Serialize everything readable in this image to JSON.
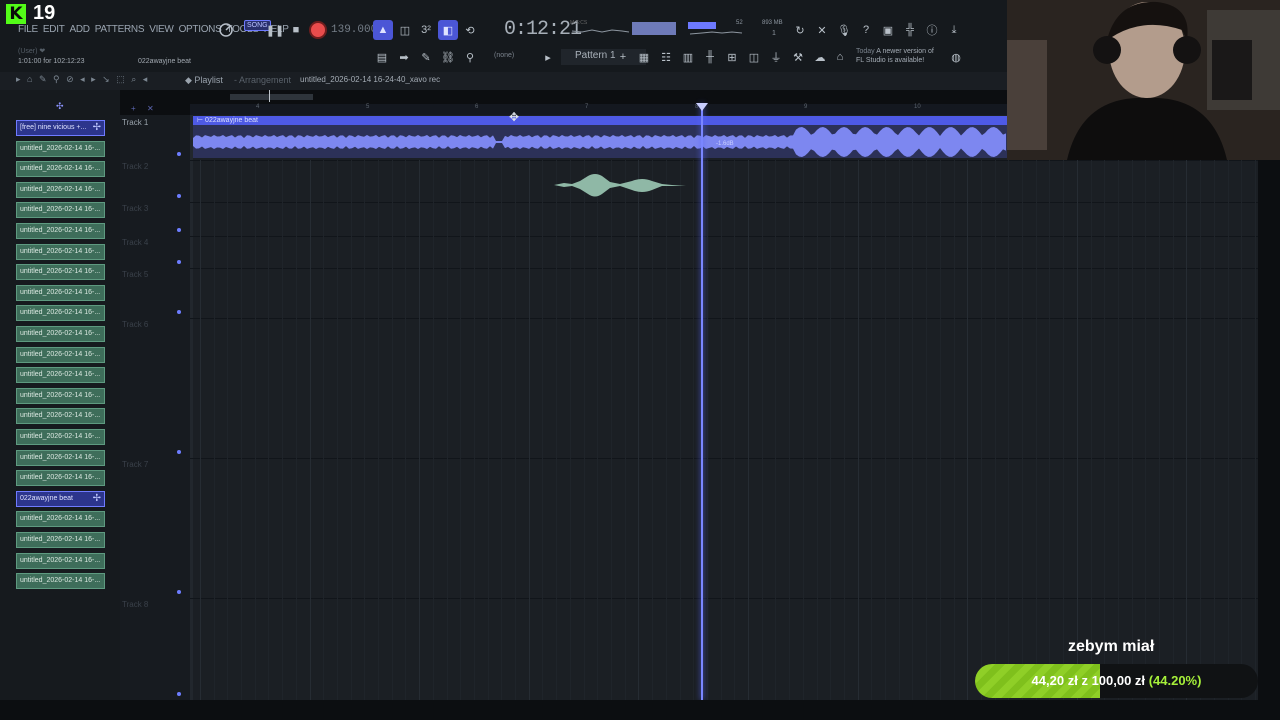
{
  "stream": {
    "viewer_count": "19",
    "logo_letter": "K",
    "caption": "zebym miał",
    "goal": {
      "current": "44,20 zł",
      "separator": "z",
      "target": "100,00 zł",
      "percent_label": "(44.20%)",
      "fraction": 0.442
    }
  },
  "menu": [
    "FILE",
    "EDIT",
    "ADD",
    "PATTERNS",
    "VIEW",
    "OPTIONS",
    "TOOLS",
    "HELP"
  ],
  "hint": {
    "user": "(User) ❤",
    "position": "1:01:00 for 102:12:23",
    "clip": "022awayjne beat"
  },
  "transport": {
    "mode": "SONG",
    "tempo": "139.000",
    "time": "0:12:21",
    "mics": "M:S:CS",
    "cpu": "52",
    "memory": "893 MB",
    "memory_sub": "1"
  },
  "pattern": {
    "name": "Pattern 1",
    "none": "(none)"
  },
  "notice": {
    "today": "Today",
    "line1": "A newer version of",
    "line2": "FL Studio is available!"
  },
  "playlist": {
    "title": "Playlist",
    "subtitle": "- Arrangement",
    "file": "untitled_2026-02-14 16-24-40_xavo rec"
  },
  "clips": [
    {
      "label": "[free] nine vicious +...",
      "selected": true
    },
    {
      "label": "untitled_2026-02-14 16-...",
      "selected": false
    },
    {
      "label": "untitled_2026-02-14 16-...",
      "selected": false
    },
    {
      "label": "untitled_2026-02-14 16-...",
      "selected": false
    },
    {
      "label": "untitled_2026-02-14 16-...",
      "selected": false
    },
    {
      "label": "untitled_2026-02-14 16-...",
      "selected": false
    },
    {
      "label": "untitled_2026-02-14 16-...",
      "selected": false
    },
    {
      "label": "untitled_2026-02-14 16-...",
      "selected": false
    },
    {
      "label": "untitled_2026-02-14 16-...",
      "selected": false
    },
    {
      "label": "untitled_2026-02-14 16-...",
      "selected": false
    },
    {
      "label": "untitled_2026-02-14 16-...",
      "selected": false
    },
    {
      "label": "untitled_2026-02-14 16-...",
      "selected": false
    },
    {
      "label": "untitled_2026-02-14 16-...",
      "selected": false
    },
    {
      "label": "untitled_2026-02-14 16-...",
      "selected": false
    },
    {
      "label": "untitled_2026-02-14 16-...",
      "selected": false
    },
    {
      "label": "untitled_2026-02-14 16-...",
      "selected": false
    },
    {
      "label": "untitled_2026-02-14 16-...",
      "selected": false
    },
    {
      "label": "untitled_2026-02-14 16-...",
      "selected": false
    },
    {
      "label": "022awayjne beat",
      "selected": true
    },
    {
      "label": "untitled_2026-02-14 16-...",
      "selected": false
    },
    {
      "label": "untitled_2026-02-14 16-...",
      "selected": false
    },
    {
      "label": "untitled_2026-02-14 16-...",
      "selected": false
    },
    {
      "label": "untitled_2026-02-14 16-...",
      "selected": false
    }
  ],
  "tracks": [
    "Track 1",
    "Track 2",
    "Track 3",
    "Track 4",
    "Track 5",
    "Track 6",
    "Track 7",
    "Track 8"
  ],
  "ruler": [
    "4",
    "5",
    "6",
    "7",
    "8",
    "9",
    "10"
  ],
  "audio_clip": {
    "name": "022awayjne beat",
    "volume": "-1.6dB"
  },
  "colors": {
    "accent": "#4e5ae6",
    "clip_green": "#3e6d5a",
    "record": "#e84c4c",
    "goal_green": "#8fcf27"
  }
}
